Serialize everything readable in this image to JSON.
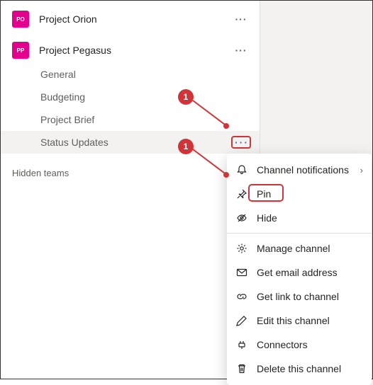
{
  "teams": [
    {
      "initials": "PO",
      "name": "Project Orion"
    },
    {
      "initials": "PP",
      "name": "Project Pegasus"
    }
  ],
  "channels": [
    {
      "label": "General"
    },
    {
      "label": "Budgeting"
    },
    {
      "label": "Project Brief"
    },
    {
      "label": "Status Updates"
    }
  ],
  "hidden_teams_label": "Hidden teams",
  "menu": {
    "notifications": "Channel notifications",
    "pin": "Pin",
    "hide": "Hide",
    "manage": "Manage channel",
    "email": "Get email address",
    "link": "Get link to channel",
    "edit": "Edit this channel",
    "connectors": "Connectors",
    "delete": "Delete this channel"
  },
  "callouts": {
    "b1": "1",
    "b2": "1"
  }
}
